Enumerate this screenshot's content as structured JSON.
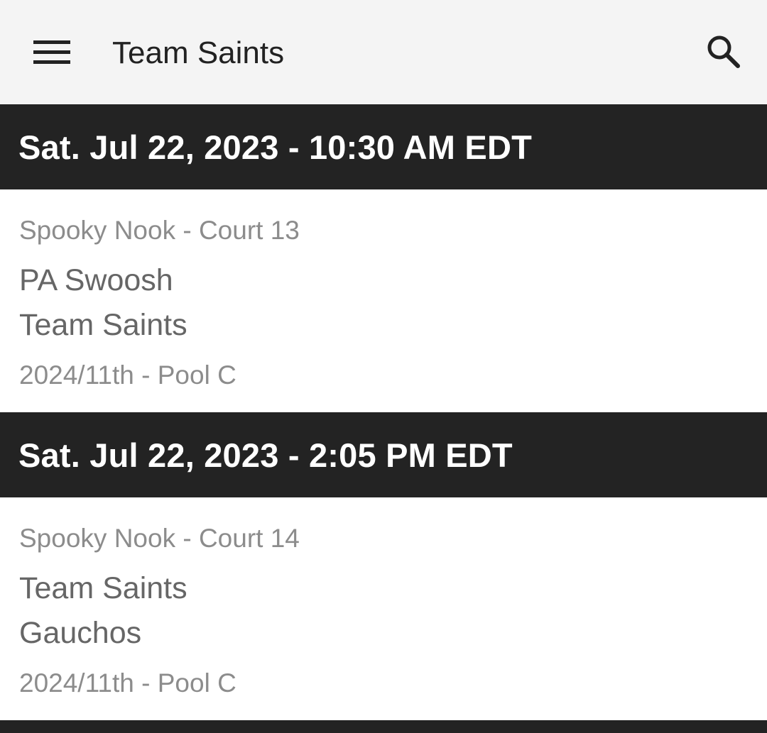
{
  "appbar": {
    "title": "Team Saints",
    "menu_icon": "hamburger-menu-icon",
    "search_icon": "search-icon"
  },
  "games": [
    {
      "datetime": "Sat. Jul 22, 2023 - 10:30 AM EDT",
      "venue": "Spooky Nook - Court 13",
      "team1": "PA Swoosh",
      "team2": "Team Saints",
      "pool": "2024/11th - Pool C"
    },
    {
      "datetime": "Sat. Jul 22, 2023 - 2:05 PM EDT",
      "venue": "Spooky Nook - Court 14",
      "team1": "Team Saints",
      "team2": "Gauchos",
      "pool": "2024/11th - Pool C"
    }
  ],
  "colors": {
    "appbar_bg": "#f4f4f4",
    "header_bg": "#232323",
    "header_text": "#ffffff",
    "secondary_text": "#8c8c8c",
    "team_text": "#666666"
  }
}
